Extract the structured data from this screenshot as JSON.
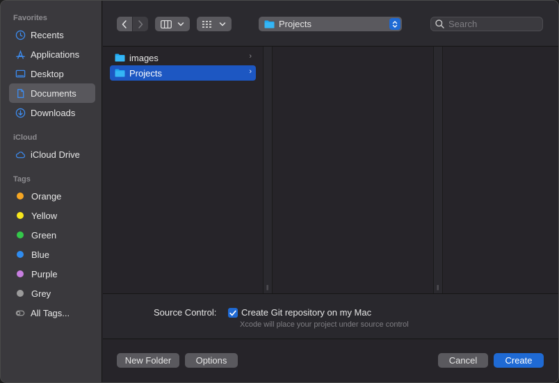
{
  "sidebar": {
    "favorites_header": "Favorites",
    "favorites": [
      {
        "label": "Recents",
        "icon": "clock-icon"
      },
      {
        "label": "Applications",
        "icon": "applications-icon"
      },
      {
        "label": "Desktop",
        "icon": "desktop-icon"
      },
      {
        "label": "Documents",
        "icon": "document-icon",
        "selected": true
      },
      {
        "label": "Downloads",
        "icon": "download-icon"
      }
    ],
    "icloud_header": "iCloud",
    "icloud_drive": "iCloud Drive",
    "tags_header": "Tags",
    "tags": [
      {
        "label": "Orange",
        "color": "#f5a623"
      },
      {
        "label": "Yellow",
        "color": "#f8e71c"
      },
      {
        "label": "Green",
        "color": "#34c84a"
      },
      {
        "label": "Blue",
        "color": "#2f8cf0"
      },
      {
        "label": "Purple",
        "color": "#c77ee0"
      },
      {
        "label": "Grey",
        "color": "#9b9b9b"
      }
    ],
    "all_tags": "All Tags..."
  },
  "toolbar": {
    "path_label": "Projects",
    "search_placeholder": "Search"
  },
  "browser": {
    "items": [
      {
        "label": "images",
        "selected": false
      },
      {
        "label": "Projects",
        "selected": true
      }
    ]
  },
  "options": {
    "source_control_label": "Source Control:",
    "git_checkbox_label": "Create Git repository on my Mac",
    "git_checked": true,
    "hint": "Xcode will place your project under source control"
  },
  "buttons": {
    "new_folder": "New Folder",
    "options": "Options",
    "cancel": "Cancel",
    "create": "Create"
  },
  "colors": {
    "accent": "#1f6ad4",
    "selection": "#1d57c2"
  }
}
